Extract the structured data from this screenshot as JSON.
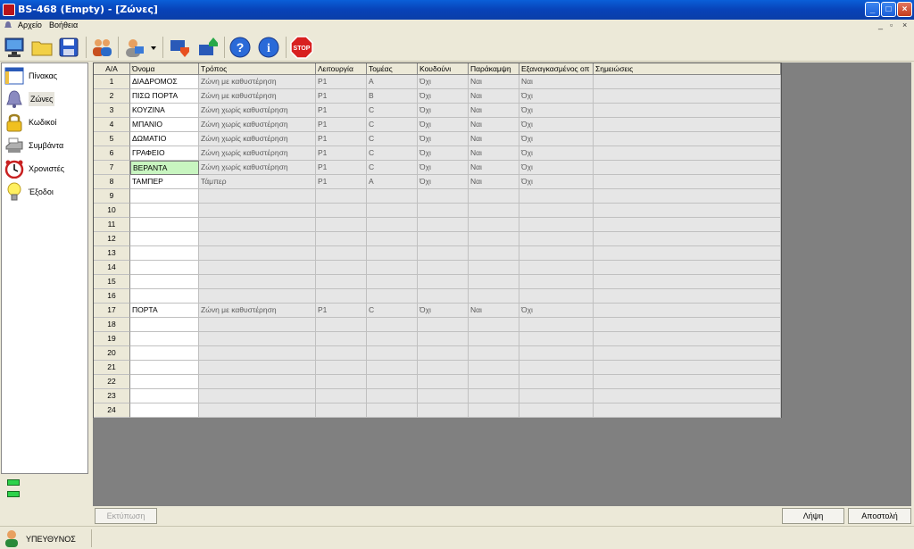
{
  "window": {
    "title": "BS-468 (Empty) - [Ζώνες]"
  },
  "menu": {
    "items": [
      "Αρχείο",
      "Βοήθεια"
    ]
  },
  "toolbar": {
    "buttons": [
      "monitor-icon",
      "folder-icon",
      "save-icon",
      "users-icon",
      "user-dropdown-icon",
      "download-icon",
      "upload-icon",
      "help-icon",
      "info-icon",
      "stop-icon"
    ],
    "stop_label": "STOP"
  },
  "sidebar": {
    "items": [
      {
        "label": "Πίνακας",
        "icon": "panel-icon"
      },
      {
        "label": "Ζώνες",
        "icon": "bell-icon"
      },
      {
        "label": "Κωδικοί",
        "icon": "lock-icon"
      },
      {
        "label": "Συμβάντα",
        "icon": "printer-icon"
      },
      {
        "label": "Χρονιστές",
        "icon": "alarm-clock-icon"
      },
      {
        "label": "Έξοδοι",
        "icon": "lightbulb-icon"
      }
    ],
    "selected": "Ζώνες"
  },
  "table": {
    "columns": [
      "Α/Α",
      "Όνομα",
      "Τρόπος",
      "Λειτουργία",
      "Τομέας",
      "Κουδούνι",
      "Παράκαμψη",
      "Εξαναγκασμένος οπ",
      "Σημειώσεις"
    ],
    "rows": [
      [
        "1",
        "ΔΙΑΔΡΟΜΟΣ",
        "Ζώνη με καθυστέρηση",
        "P1",
        "A",
        "Όχι",
        "Ναι",
        "Ναι",
        ""
      ],
      [
        "2",
        "ΠΙΣΩ ΠΟΡΤΑ",
        "Ζώνη με καθυστέρηση",
        "P1",
        "B",
        "Όχι",
        "Ναι",
        "Όχι",
        ""
      ],
      [
        "3",
        "ΚΟΥΖΙΝΑ",
        "Ζώνη χωρίς καθυστέρηση",
        "P1",
        "C",
        "Όχι",
        "Ναι",
        "Όχι",
        ""
      ],
      [
        "4",
        "ΜΠΑΝΙΟ",
        "Ζώνη χωρίς καθυστέρηση",
        "P1",
        "C",
        "Όχι",
        "Ναι",
        "Όχι",
        ""
      ],
      [
        "5",
        "ΔΩΜΑΤΙΟ",
        "Ζώνη χωρίς καθυστέρηση",
        "P1",
        "C",
        "Όχι",
        "Ναι",
        "Όχι",
        ""
      ],
      [
        "6",
        "ΓΡΑΦΕΙΟ",
        "Ζώνη χωρίς καθυστέρηση",
        "P1",
        "C",
        "Όχι",
        "Ναι",
        "Όχι",
        ""
      ],
      [
        "7",
        "ΒΕΡΑΝΤΑ",
        "Ζώνη χωρίς καθυστέρηση",
        "P1",
        "C",
        "Όχι",
        "Ναι",
        "Όχι",
        ""
      ],
      [
        "8",
        "ΤΑΜΠΕΡ",
        "Τάμπερ",
        "P1",
        "A",
        "Όχι",
        "Ναι",
        "Όχι",
        ""
      ],
      [
        "9",
        "",
        "",
        "",
        "",
        "",
        "",
        "",
        ""
      ],
      [
        "10",
        "",
        "",
        "",
        "",
        "",
        "",
        "",
        ""
      ],
      [
        "11",
        "",
        "",
        "",
        "",
        "",
        "",
        "",
        ""
      ],
      [
        "12",
        "",
        "",
        "",
        "",
        "",
        "",
        "",
        ""
      ],
      [
        "13",
        "",
        "",
        "",
        "",
        "",
        "",
        "",
        ""
      ],
      [
        "14",
        "",
        "",
        "",
        "",
        "",
        "",
        "",
        ""
      ],
      [
        "15",
        "",
        "",
        "",
        "",
        "",
        "",
        "",
        ""
      ],
      [
        "16",
        "",
        "",
        "",
        "",
        "",
        "",
        "",
        ""
      ],
      [
        "17",
        "ΠΟΡΤΑ",
        "Ζώνη με καθυστέρηση",
        "P1",
        "C",
        "Όχι",
        "Ναι",
        "Όχι",
        ""
      ],
      [
        "18",
        "",
        "",
        "",
        "",
        "",
        "",
        "",
        ""
      ],
      [
        "19",
        "",
        "",
        "",
        "",
        "",
        "",
        "",
        ""
      ],
      [
        "20",
        "",
        "",
        "",
        "",
        "",
        "",
        "",
        ""
      ],
      [
        "21",
        "",
        "",
        "",
        "",
        "",
        "",
        "",
        ""
      ],
      [
        "22",
        "",
        "",
        "",
        "",
        "",
        "",
        "",
        ""
      ],
      [
        "23",
        "",
        "",
        "",
        "",
        "",
        "",
        "",
        ""
      ],
      [
        "24",
        "",
        "",
        "",
        "",
        "",
        "",
        "",
        ""
      ]
    ],
    "selected_row": 7
  },
  "buttons": {
    "print": "Εκτύπωση",
    "receive": "Λήψη",
    "send": "Αποστολή"
  },
  "status": {
    "user": "ΥΠΕΥΘΥΝΟΣ"
  },
  "colors": {
    "title_blue": "#0842b8",
    "selected_cell": "#c8f5c0",
    "led_green": "#2dd24a"
  }
}
